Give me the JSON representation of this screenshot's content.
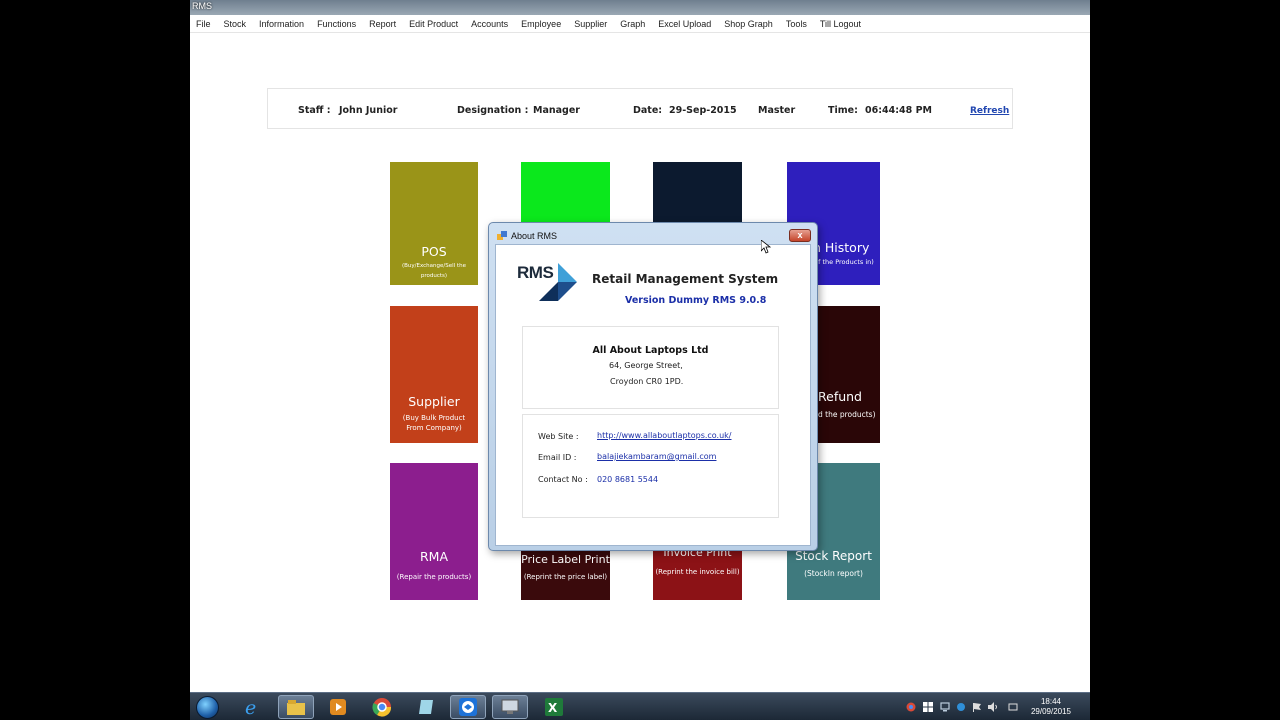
{
  "window": {
    "title": "RMS"
  },
  "menu": [
    "File",
    "Stock",
    "Information",
    "Functions",
    "Report",
    "Edit Product",
    "Accounts",
    "Employee",
    "Supplier",
    "Graph",
    "Excel Upload",
    "Shop Graph",
    "Tools",
    "Till Logout"
  ],
  "infobar": {
    "staff_label": "Staff :",
    "staff_value": "John Junior",
    "designation_label": "Designation :",
    "designation_value": "Manager",
    "date_label": "Date:",
    "date_value": "29-Sep-2015",
    "mode": "Master",
    "time_label": "Time:",
    "time_value": "06:44:48 PM",
    "refresh": "Refresh"
  },
  "tiles": [
    {
      "title": "POS",
      "subtitle": "(Buy/Exchange/Sell the products)",
      "color": "#9a9418"
    },
    {
      "title": "",
      "subtitle": "",
      "color": "#0be81c"
    },
    {
      "title": "",
      "subtitle": "",
      "color": "#0c1a2f"
    },
    {
      "title": "n History",
      "subtitle": "Of the Products in)",
      "color": "#2e1fbd"
    },
    {
      "title": "Supplier",
      "subtitle": "(Buy Bulk Product From Company)",
      "color": "#c2401a"
    },
    {
      "title": "Refund",
      "subtitle": "d the products)",
      "color": "#2a0607"
    },
    {
      "title": "RMA",
      "subtitle": "(Repair the products)",
      "color": "#8c1e8e"
    },
    {
      "title": "Price Label Print",
      "subtitle": "(Reprint the price label)",
      "color": "#3a0a0c"
    },
    {
      "title": "Invoice Print",
      "subtitle": "(Reprint the invoice bill)",
      "color": "#8c1216"
    },
    {
      "title": "Stock Report",
      "subtitle": "(StockIn report)",
      "color": "#3f7a7e"
    }
  ],
  "about": {
    "title": "About RMS",
    "close": "x",
    "logo_text": "RMS",
    "app_name": "Retail Management System",
    "version": "Version Dummy RMS 9.0.8",
    "company": {
      "name": "All About Laptops Ltd",
      "address1": "64, George Street,",
      "address2": "Croydon CR0 1PD."
    },
    "contact": {
      "website_label": "Web Site :",
      "website": "http://www.allaboutlaptops.co.uk/",
      "email_label": "Email ID :",
      "email": "balajiekambaram@gmail.com",
      "phone_label": "Contact No :",
      "phone": "020 8681 5544"
    }
  },
  "taskbar": {
    "apps": [
      "internet-explorer-icon",
      "file-explorer-icon",
      "media-player-icon",
      "chrome-icon",
      "notes-icon",
      "teamviewer-icon",
      "rms-app-icon",
      "excel-icon"
    ],
    "clock_time": "18:44",
    "clock_date": "29/09/2015"
  }
}
